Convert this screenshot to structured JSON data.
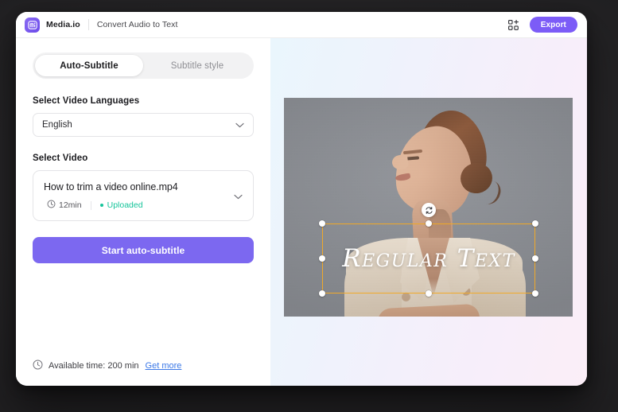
{
  "topbar": {
    "logo_icon": "media-io-logo-icon",
    "brand": "Media.io",
    "subtitle": "Convert Audio to Text",
    "grid_icon": "apps-grid-icon",
    "export_label": "Export"
  },
  "tabs": [
    {
      "label": "Auto-Subtitle",
      "active": true
    },
    {
      "label": "Subtitle style",
      "active": false
    }
  ],
  "language": {
    "label": "Select Video Languages",
    "value": "English",
    "chevron_icon": "chevron-down-icon"
  },
  "video": {
    "label": "Select Video",
    "filename": "How to trim a video online.mp4",
    "clock_icon": "clock-icon",
    "duration": "12min",
    "status": "Uploaded",
    "status_color": "#15c49a",
    "chevron_icon": "chevron-down-icon"
  },
  "cta": {
    "label": "Start auto-subtitle",
    "color": "#7c68f0"
  },
  "footer": {
    "clock_icon": "clock-icon",
    "available_time": "Available time: 200 min",
    "get_more_label": "Get more",
    "link_color": "#3b78e7"
  },
  "preview": {
    "subtitle_text": "Regular Text",
    "selection_color": "#f0a92a",
    "rotate_icon": "rotate-icon",
    "handles": [
      "handle-top-left",
      "handle-top-center",
      "handle-top-right",
      "handle-middle-left",
      "handle-middle-right",
      "handle-bottom-left",
      "handle-bottom-center",
      "handle-bottom-right"
    ]
  }
}
